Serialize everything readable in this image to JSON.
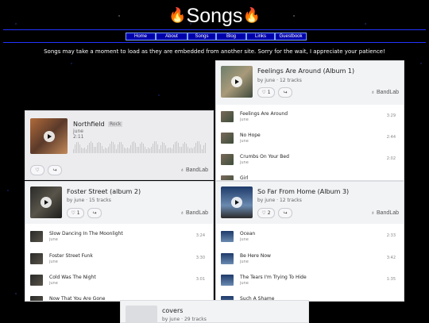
{
  "header": {
    "title": "Songs",
    "flame_icon": "🔥"
  },
  "nav": [
    {
      "label": "Home"
    },
    {
      "label": "About"
    },
    {
      "label": "Songs"
    },
    {
      "label": "Blog"
    },
    {
      "label": "Links"
    },
    {
      "label": "Guestbook"
    }
  ],
  "notice": "Songs may take a moment to load as they are embedded from another site. Sorry for the wait, I appreciate your patience!",
  "embeds": {
    "feelings": {
      "title": "Feelings Are Around (Album 1)",
      "sub": "by june · 12 tracks",
      "likes": "1",
      "brand": "BandLab",
      "tracks": [
        {
          "name": "Feelings Are Around",
          "artist": "june",
          "dur": "3:29"
        },
        {
          "name": "No Hope",
          "artist": "june",
          "dur": "2:44"
        },
        {
          "name": "Crumbs On Your Bed",
          "artist": "june",
          "dur": "2:02"
        },
        {
          "name": "Girl",
          "artist": "",
          "dur": ""
        }
      ]
    },
    "northfield": {
      "title": "Northfield",
      "tag": "Rock",
      "artist": "june",
      "time": "2:11",
      "brand": "BandLab"
    },
    "foster": {
      "title": "Foster Street (album 2)",
      "sub": "by june · 15 tracks",
      "likes": "1",
      "brand": "BandLab",
      "tracks": [
        {
          "name": "Slow Dancing In The Moonlight",
          "artist": "june",
          "dur": "3:24"
        },
        {
          "name": "Foster Street Funk",
          "artist": "june",
          "dur": "3:30"
        },
        {
          "name": "Cold Was The Night",
          "artist": "june",
          "dur": "3:01"
        },
        {
          "name": "Now That You Are Gone",
          "artist": "",
          "dur": ""
        }
      ]
    },
    "sofar": {
      "title": "So Far From Home (Album 3)",
      "sub": "by june · 12 tracks",
      "likes": "2",
      "brand": "BandLab",
      "tracks": [
        {
          "name": "Ocean",
          "artist": "june",
          "dur": "2:33"
        },
        {
          "name": "Be Here Now",
          "artist": "june",
          "dur": "3:42"
        },
        {
          "name": "The Tears I'm Trying To Hide",
          "artist": "june",
          "dur": "1:35"
        },
        {
          "name": "Such A Shame",
          "artist": "",
          "dur": ""
        }
      ]
    },
    "covers": {
      "title": "covers",
      "sub": "by june · 29 tracks"
    }
  },
  "icons": {
    "play": "play-icon",
    "like": "heart-icon",
    "share": "share-icon",
    "bandlab": "bandlab-logo-icon"
  }
}
